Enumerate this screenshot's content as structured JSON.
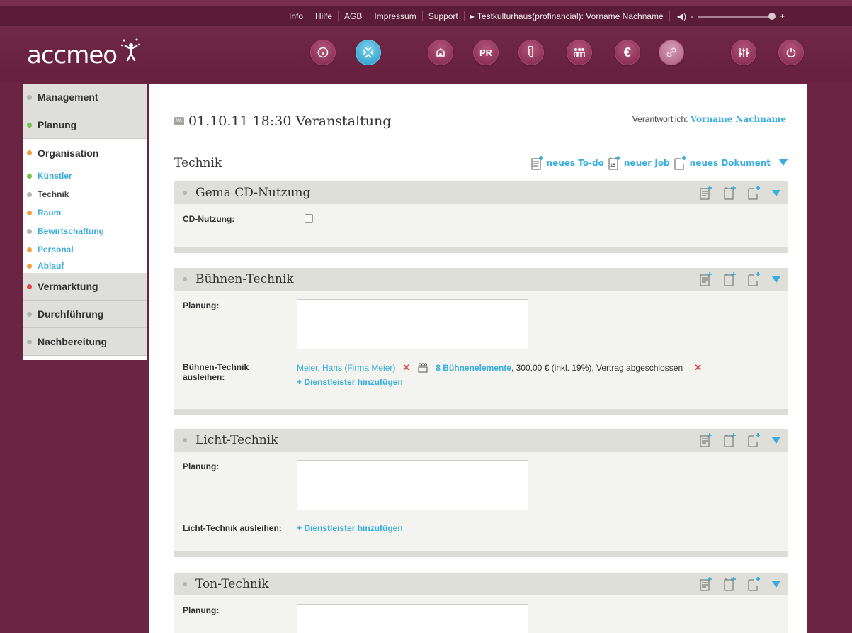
{
  "topmenu": {
    "items": [
      "Info",
      "Hilfe",
      "AGB",
      "Impressum",
      "Support"
    ],
    "user": "Testkulturhaus(profinancial): Vorname Nachname",
    "vol_minus": "-",
    "vol_plus": "+"
  },
  "logo": "accmeo",
  "nav": {
    "pr_label": "PR",
    "euro_label": "€"
  },
  "sidebar": {
    "main1": "Management",
    "main2": "Planung",
    "main3": "Organisation",
    "sub": [
      "Künstler",
      "Technik",
      "Raum",
      "Bewirtschaftung",
      "Personal",
      "Ablauf"
    ],
    "main4": "Vermarktung",
    "main5": "Durchführung",
    "main6": "Nachbereitung"
  },
  "event": {
    "badge": "VA",
    "title": "01.10.11 18:30 Veranstaltung",
    "resp_label": "Verantwortlich:",
    "resp_name": "Vorname Nachname"
  },
  "page": {
    "section_title": "Technik",
    "new_todo": "neues To-do",
    "new_job": "neuer Job",
    "new_doc": "neues Dokument"
  },
  "sections": {
    "gema": {
      "title": "Gema CD-Nutzung",
      "label": "CD-Nutzung:"
    },
    "buehne": {
      "title": "Bühnen-Technik",
      "planung": "Planung:",
      "ausleihen_l1": "Bühnen-Technik",
      "ausleihen_l2": "ausleihen:",
      "provider": "Meier, Hans (Firma Meier)",
      "item_link": "8 Bühnenelemente",
      "item_detail": ", 300,00 € (inkl. 19%), Vertrag abgeschlossen",
      "add": "+ Dienstleister hinzufügen"
    },
    "licht": {
      "title": "Licht-Technik",
      "planung": "Planung:",
      "ausleihen": "Licht-Technik ausleihen:",
      "add": "+ Dienstleister hinzufügen"
    },
    "ton": {
      "title": "Ton-Technik",
      "planung": "Planung:"
    }
  },
  "colors": {
    "accent": "#3aaedc",
    "brand": "#6b2442",
    "delete": "#e04343"
  }
}
